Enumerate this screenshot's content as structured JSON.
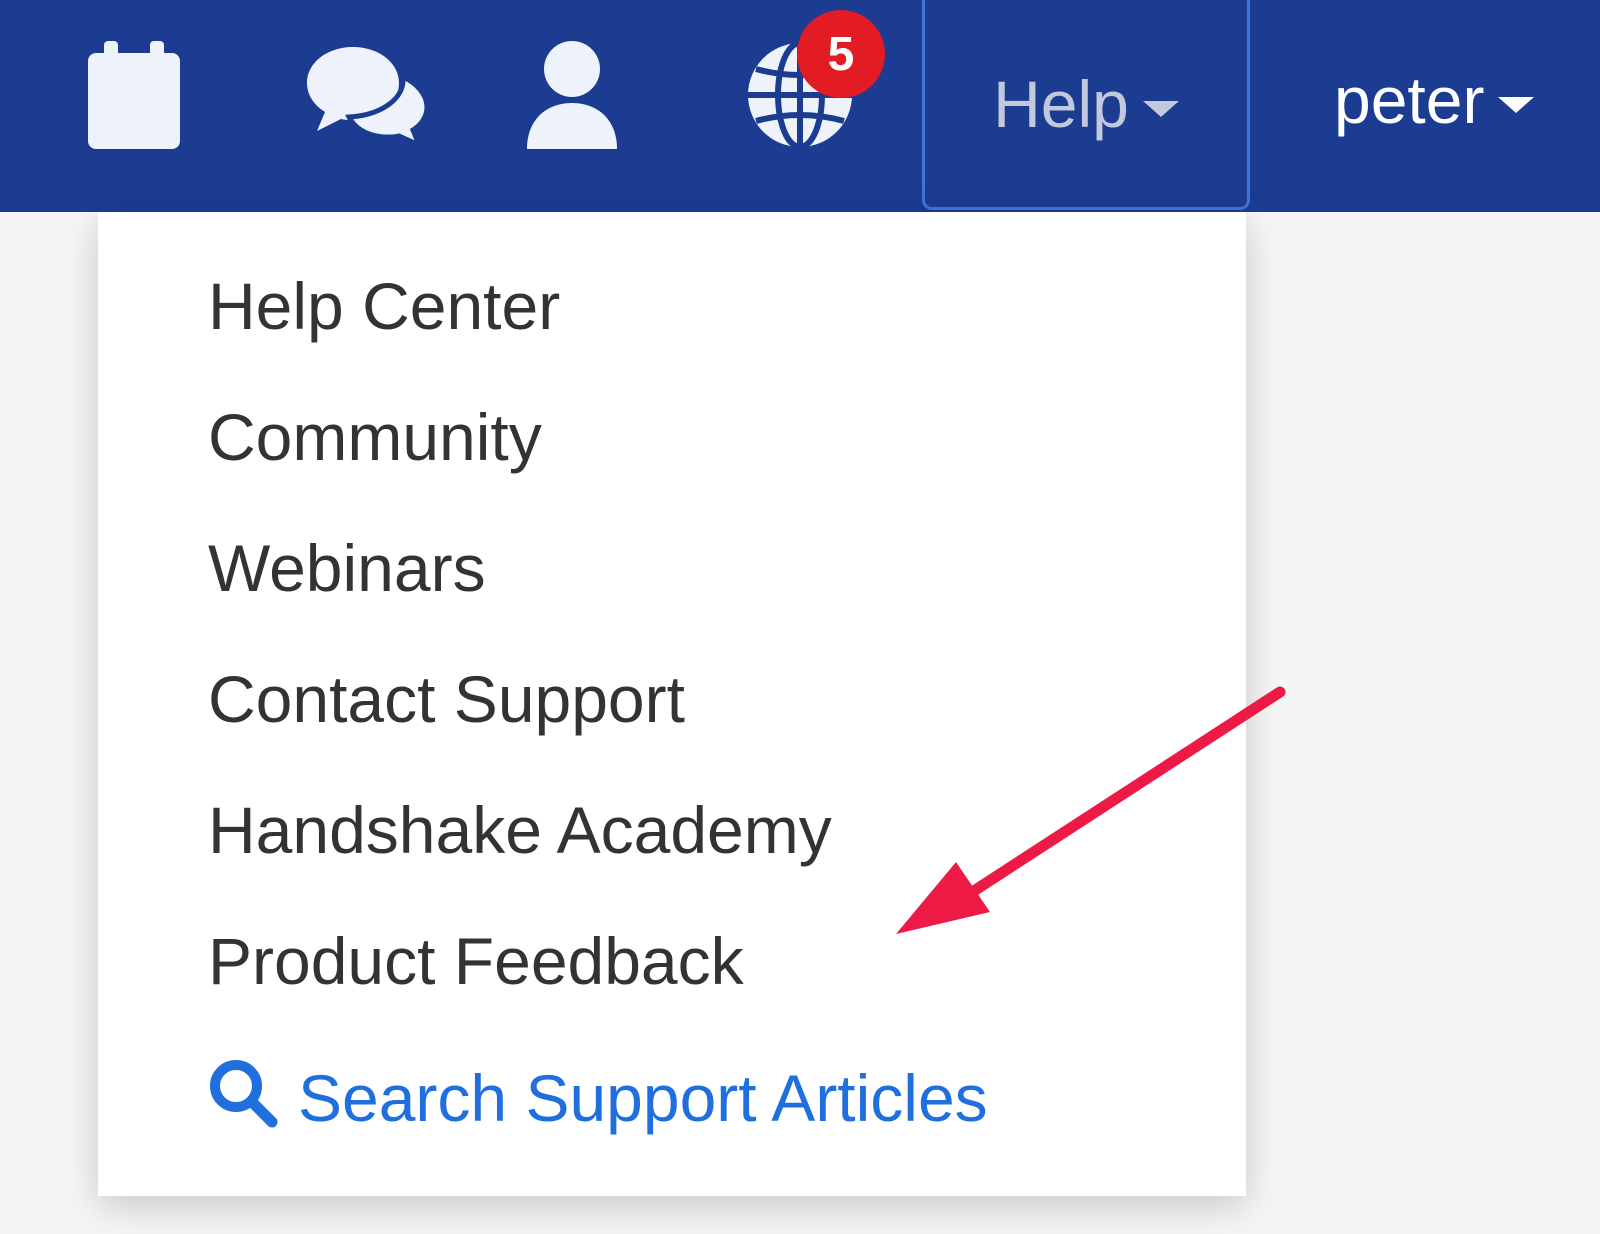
{
  "navbar": {
    "background": "#1b3c91",
    "icons": [
      {
        "name": "calendar-icon"
      },
      {
        "name": "chat-icon"
      },
      {
        "name": "user-icon"
      },
      {
        "name": "globe-icon",
        "badge": "5"
      }
    ],
    "help_label": "Help",
    "user_label": "peter"
  },
  "dropdown": {
    "items": [
      "Help Center",
      "Community",
      "Webinars",
      "Contact Support",
      "Handshake Academy",
      "Product Feedback"
    ],
    "search_link": {
      "icon": "search-icon",
      "label": "Search Support Articles",
      "color": "#1f6fde"
    }
  },
  "annotation": {
    "type": "arrow",
    "color": "#ec1a45"
  }
}
